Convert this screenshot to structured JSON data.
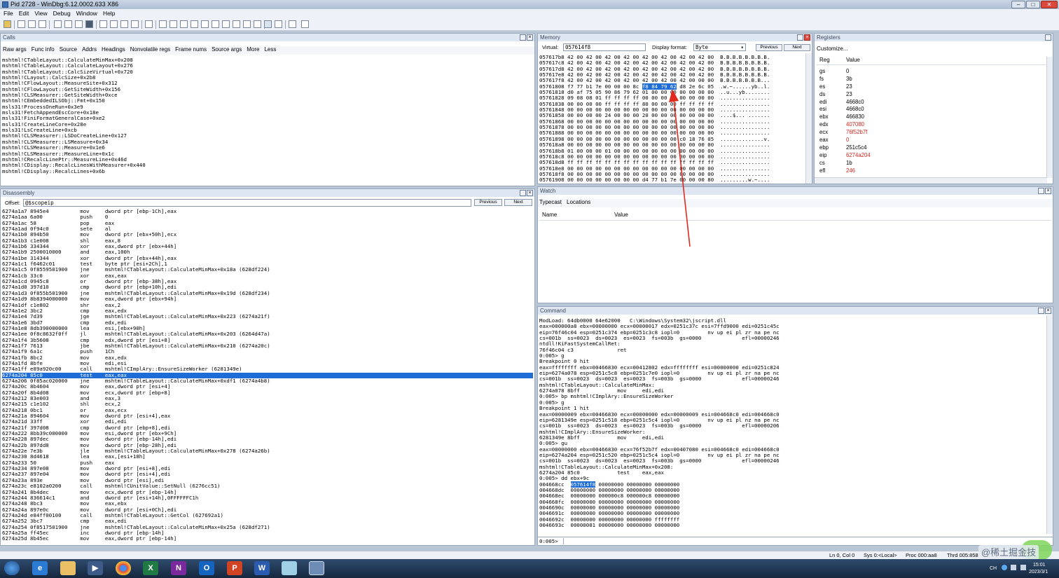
{
  "window": {
    "title": "Pid 2728 - WinDbg:6.12.0002.633 X86"
  },
  "menu": [
    "File",
    "Edit",
    "View",
    "Debug",
    "Window",
    "Help"
  ],
  "calls": {
    "title": "Calls",
    "tabs": [
      "Raw args",
      "Func info",
      "Source",
      "Addrs",
      "Headings",
      "Nonvolatile regs",
      "Frame nums",
      "Source args",
      "More",
      "Less"
    ],
    "frames": [
      "mshtml!CTableLayout::CalculateMinMax+0x208",
      "mshtml!CTableLayout::CalculateLayout+0x276",
      "mshtml!CTableLayout::CalcSizeVirtual+0x720",
      "mshtml!CLayout::CalcSize+0x2b8",
      "mshtml!CFlowLayout::MeasureSite+0x312",
      "mshtml!CFlowLayout::GetSiteWidth+0x156",
      "mshtml!CLSMeasurer::GetSiteWidth+0xce",
      "mshtml!CEmbeddedILSObj::Fmt+0x150",
      "msls31!ProcessOneRun+0x3e9",
      "msls31!FetchAppendEscCore+0x18e",
      "msls31!FiniFormatGeneralCase+0xe2",
      "msls31!CreateLineCore+0x28e",
      "msls31!LsCreateLine+0xcb",
      "mshtml!CLSMeasurer::LSDoCreateLine+0x127",
      "mshtml!CLSMeasurer::LSMeasure+0x34",
      "mshtml!CLSMeasurer::Measure+0x1e6",
      "mshtml!CLSMeasurer::MeasureLine+0x1c",
      "mshtml!CRecalcLinePtr::MeasureLine+0x46d",
      "mshtml!CDisplay::RecalcLinesWithMeasurer+0x440",
      "mshtml!CDisplay::RecalcLines+0x6b"
    ]
  },
  "memory": {
    "title": "Memory",
    "virtual_label": "Virtual:",
    "virtual_value": "057614f8",
    "format_label": "Display format:",
    "format_value": "Byte",
    "prev": "Previous",
    "next": "Next",
    "rows_before": [
      "057617b8 42 00 42 00 42 00 42 00 42 00 42 00 42 00 42 00  B.B.B.B.B.B.B.B.",
      "057617c8 42 00 42 00 42 00 42 00 42 00 42 00 42 00 42 00  B.B.B.B.B.B.B.B.",
      "057617d8 42 00 42 00 42 00 42 00 42 00 42 00 42 00 42 00  B.B.B.B.B.B.B.B.",
      "057617e8 42 00 42 00 42 00 42 00 42 00 42 00 42 00 42 00  B.B.B.B.B.B.B.B.",
      "057617f8 42 00 42 00 42 00 42 00 42 00 42 00 42 00 00 00  B.B.B.B.B.B.B..."
    ],
    "hl_row_prefix": "05761808 f7 77 b1 7e 00 00 00 8c ",
    "hl_bytes": "f8 84 79 62",
    "hl_row_suffix": " d8 2e 6c 05  .w.~......yb..l.",
    "rows_after": [
      "05761818 d0 af 75 05 90 86 79 62 01 00 00 00 00 00 00 00  ..u...yb........",
      "05761828 09 08 08 01 ff ff ff ff 00 00 00 00 00 00 00 00  ................",
      "05761838 00 00 00 00 ff ff ff ff 80 00 00 00 ff ff ff ff  ................",
      "05761848 00 00 00 00 00 00 00 00 00 00 00 00 00 00 00 00  ................",
      "05761858 00 00 00 00 24 00 00 00 20 00 00 00 00 00 00 00  ....$... .......",
      "05761868 00 00 00 00 00 00 00 00 00 00 00 00 00 00 00 00  ................",
      "05761878 00 00 00 00 00 00 00 00 00 00 00 00 00 00 00 00  ................",
      "05761888 00 00 00 00 00 00 00 00 00 00 00 00 00 00 00 00  ................",
      "05761898 00 00 00 00 00 00 00 00 00 00 00 00 c0 18 76 05  ..............v.",
      "057618a8 00 00 00 00 00 00 00 00 00 00 00 00 00 00 00 00  ................",
      "057618b8 01 00 00 00 01 00 00 00 00 00 00 00 00 00 00 00  ................",
      "057618c8 00 00 00 00 00 00 00 00 00 00 00 00 00 00 00 00  ................",
      "057618d8 ff ff ff ff ff ff ff ff ff ff ff ff ff ff ff ff  ................",
      "057618e8 00 00 00 00 00 00 00 00 00 00 00 00 00 00 00 00  ................",
      "057618f8 00 00 00 00 00 00 00 00 00 00 00 00 00 00 00 00  ................",
      "05761908 00 00 00 00 00 00 00 00 d4 77 b1 7e 00 00 00 80  .........w.~...."
    ]
  },
  "registers": {
    "title": "Registers",
    "customize": "Customize...",
    "col_reg": "Reg",
    "col_value": "Value",
    "items": [
      {
        "name": "gs",
        "value": "0",
        "changed": false
      },
      {
        "name": "fs",
        "value": "3b",
        "changed": false
      },
      {
        "name": "es",
        "value": "23",
        "changed": false
      },
      {
        "name": "ds",
        "value": "23",
        "changed": false
      },
      {
        "name": "edi",
        "value": "4668c0",
        "changed": false
      },
      {
        "name": "esi",
        "value": "4668c0",
        "changed": false
      },
      {
        "name": "ebx",
        "value": "466830",
        "changed": false
      },
      {
        "name": "edx",
        "value": "407080",
        "changed": true
      },
      {
        "name": "ecx",
        "value": "76f52b7f",
        "changed": true
      },
      {
        "name": "eax",
        "value": "0",
        "changed": true
      },
      {
        "name": "ebp",
        "value": "251c5c4",
        "changed": false
      },
      {
        "name": "eip",
        "value": "6274a204",
        "changed": true
      },
      {
        "name": "cs",
        "value": "1b",
        "changed": false
      },
      {
        "name": "efl",
        "value": "246",
        "changed": true
      }
    ]
  },
  "watch": {
    "title": "Watch",
    "tabs": [
      "Typecast",
      "Locations"
    ],
    "col_name": "Name",
    "col_value": "Value"
  },
  "disasm": {
    "title": "Disassembly",
    "offset_label": "Offset:",
    "offset_value": "@$scopeip",
    "prev": "Previous",
    "next": "Next",
    "current_index": 28,
    "lines": [
      "6274a1a7 8945e4          mov     dword ptr [ebp-1Ch],eax",
      "6274a1aa 6a00            push    0",
      "6274a1ac 58              pop     eax",
      "6274a1ad 0f94c0          sete    al",
      "6274a1b0 894b50          mov     dword ptr [ebx+50h],ecx",
      "6274a1b3 c1e008          shl     eax,8",
      "6274a1b6 334344          xor     eax,dword ptr [ebx+44h]",
      "6274a1b9 2500010000      and     eax,100h",
      "6274a1be 314344          xor     dword ptr [ebx+44h],eax",
      "6274a1c1 f6462c01        test    byte ptr [esi+2Ch],1",
      "6274a1c5 0f8559501900    jne     mshtml!CTableLayout::CalculateMinMax+0x18a (628df224)",
      "6274a1cb 33c0            xor     eax,eax",
      "6274a1cd 0945c8          or      dword ptr [ebp-38h],eax",
      "6274a1d0 397d10          cmp     dword ptr [ebp+10h],edi",
      "6274a1d3 0f855b501900    jne     mshtml!CTableLayout::CalculateMinMax+0x19d (628df234)",
      "6274a1d9 8b8394000000    mov     eax,dword ptr [ebx+94h]",
      "6274a1df c1e802          shr     eax,2",
      "6274a1e2 3bc2            cmp     eax,edx",
      "6274a1e4 7d39            jge     mshtml!CTableLayout::CalculateMinMax+0x223 (6274a21f)",
      "6274a1e6 3bd7            cmp     edx,edi",
      "6274a1e8 8db390000000    lea     esi,[ebx+90h]",
      "6274a1ee 0f8c8632f0ff    jl      mshtml!CTableLayout::CalculateMinMax+0x203 (6264d47a)",
      "6274a1f4 3b5608          cmp     edx,dword ptr [esi+8]",
      "6274a1f7 7613            jbe     mshtml!CTableLayout::CalculateMinMax+0x210 (6274a20c)",
      "6274a1f9 6a1c            push    1Ch",
      "6274a1fb 8bc2            mov     eax,edx",
      "6274a1fd 8bfe            mov     edi,esi",
      "6274a1ff e89a920c00      call    mshtml!CImplAry::EnsureSizeWorker (6281349e)",
      "6274a204 85c0            test    eax,eax",
      "6274a206 0f85ac020000    jne     mshtml!CTableLayout::CalculateMinMax+0xdf1 (6274a4b8)",
      "6274a20c 8b4604          mov     eax,dword ptr [esi+4]",
      "6274a20f 8b4d08          mov     ecx,dword ptr [ebp+8]",
      "6274a212 83e003          and     eax,3",
      "6274a215 c1e102          shl     ecx,2",
      "6274a218 0bc1            or      eax,ecx",
      "6274a21a 894604          mov     dword ptr [esi+4],eax",
      "6274a21d 33ff            xor     edi,edi",
      "6274a21f 397d08          cmp     dword ptr [ebp+8],edi",
      "6274a222 8bb39c000000    mov     esi,dword ptr [ebx+9Ch]",
      "6274a228 897dec          mov     dword ptr [ebp-14h],edi",
      "6274a22b 897dd8          mov     dword ptr [ebp-28h],edi",
      "6274a22e 7e3b            jle     mshtml!CTableLayout::CalculateMinMax+0x278 (6274a26b)",
      "6274a230 8d4618          lea     eax,[esi+18h]",
      "6274a233 50              push    eax",
      "6274a234 897e08          mov     dword ptr [esi+8],edi",
      "6274a237 897e04          mov     dword ptr [esi+4],edi",
      "6274a23a 893e            mov     dword ptr [esi],edi",
      "6274a23c e8102a0200      call    mshtml!CUnitValue::SetNull (6276cc51)",
      "6274a241 8b4dec          mov     ecx,dword ptr [ebp-14h]",
      "6274a244 836614c1        and     dword ptr [esi+14h],0FFFFFFC1h",
      "6274a248 8bc3            mov     eax,ebx",
      "6274a24a 897e0c          mov     dword ptr [esi+0Ch],edi",
      "6274a24d e84ff00100      call    mshtml!CTableLayout::GetCol (627692a1)",
      "6274a252 3bc7            cmp     eax,edi",
      "6274a254 0f8517501900    jne     mshtml!CTableLayout::CalculateMinMax+0x25a (628df271)",
      "6274a25a ff45ec          inc     dword ptr [ebp-14h]",
      "6274a25d 8b45ec          mov     eax,dword ptr [ebp-14h]"
    ]
  },
  "command": {
    "title": "Command",
    "lines": [
      "ModLoad: 64db0000 64e62000   C:\\Windows\\System32\\jscript.dll",
      "eax=000000a8 ebx=00000000 ecx=00000017 edx=0251c37c esi=7ffd9000 edi=0251c45c",
      "eip=76f46c04 esp=0251c374 ebp=0251c3c8 iopl=0         nv up ei pl zr na pe nc",
      "cs=001b  ss=0023  ds=0023  es=0023  fs=003b  gs=0000             efl=00000246",
      "ntdll!KiFastSystemCallRet:",
      "76f46c04 c3              ret",
      "0:005> g",
      "Breakpoint 0 hit",
      "eax=ffffffff ebx=00466830 ecx=00412802 edx=ffffffff esi=00000000 edi=0251c824",
      "eip=6274a078 esp=0251c5c8 ebp=0251c7e0 iopl=0         nv up ei pl zr na pe nc",
      "cs=001b  ss=0023  ds=0023  es=0023  fs=003b  gs=0000             efl=00000246",
      "mshtml!CTableLayout::CalculateMinMax:",
      "6274a078 8bff            mov     edi,edi",
      "0:005> bp mshtml!CImplAry::EnsureSizeWorker",
      "0:005> g",
      "Breakpoint 1 hit",
      "eax=00000009 ebx=00466830 ecx=00000000 edx=00000009 esi=004668c0 edi=004668c0",
      "eip=6281349e esp=0251c518 ebp=0251c5c4 iopl=0         nv up ei pl nz na pe nc",
      "cs=001b  ss=0023  ds=0023  es=0023  fs=003b  gs=0000             efl=00000206",
      "mshtml!CImplAry::EnsureSizeWorker:",
      "6281349e 8bff            mov     edi,edi",
      "0:005> gu",
      "eax=00000000 ebx=00466830 ecx=76f52b7f edx=00407080 esi=004668c0 edi=004668c0",
      "eip=6274a204 esp=0251c520 ebp=0251c5c4 iopl=0         nv up ei pl zr na pe nc",
      "cs=001b  ss=0023  ds=0023  es=0023  fs=003b  gs=0000             efl=00000246",
      "mshtml!CTableLayout::CalculateMinMax+0x208:",
      "6274a204 85c0            test    eax,eax",
      "0:005> dd ebx+9c"
    ],
    "dd_first_addr": "004668cc  ",
    "dd_first_hl": "057614f8",
    "dd_first_rest": " 00000000 00000000 00000000",
    "dd_lines": [
      "004668dc  00000000 00000000 00000000 00000000",
      "004668ec  00000000 000000c8 000000c8 00000000",
      "004668fc  00000000 00000000 00000000 00000000",
      "0046690c  00000000 00000000 00000000 00000000",
      "0046691c  00000000 00000000 00000000 00000000",
      "0046692c  00000000 00000000 00000000 ffffffff",
      "0046693c  00000001 00000000 00000000 00000000"
    ],
    "prompt": "0:005>"
  },
  "status": {
    "position": "Ln 0, Col 0",
    "sys": "Sys 0:<Local>",
    "proc": "Proc 000:aa8",
    "thrd": "Thrd 005:858"
  },
  "watermark": "@稀土掘金技术社区",
  "clock": {
    "time": "15:01",
    "date": "2023/3/1"
  },
  "taskbar_apps": [
    "start",
    "ie",
    "explorer",
    "media",
    "chrome",
    "excel",
    "onenote",
    "outlook",
    "powerpoint",
    "word",
    "notepad",
    "windbg"
  ]
}
